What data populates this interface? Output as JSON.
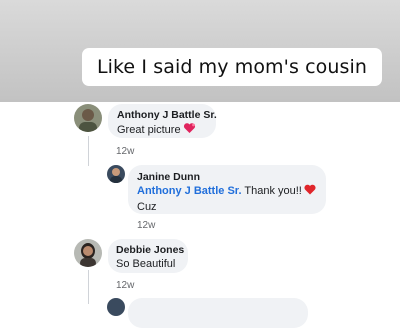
{
  "overlay": {
    "caption": "Like I said my mom's cousin"
  },
  "comments": [
    {
      "author": "Anthony J Battle Sr.",
      "text": "Great picture",
      "emoji": "heart-emoji",
      "time": "12w"
    },
    {
      "author": "Janine Dunn",
      "mention": "Anthony J Battle Sr.",
      "text": "Thank you!!",
      "emoji": "red-heart-emoji",
      "text2": "Cuz",
      "time": "12w"
    },
    {
      "author": "Debbie Jones",
      "text": "So Beautiful",
      "time": "12w"
    }
  ],
  "colors": {
    "mention": "#216fdb",
    "bubble": "#f0f2f5",
    "meta": "#65676b"
  }
}
